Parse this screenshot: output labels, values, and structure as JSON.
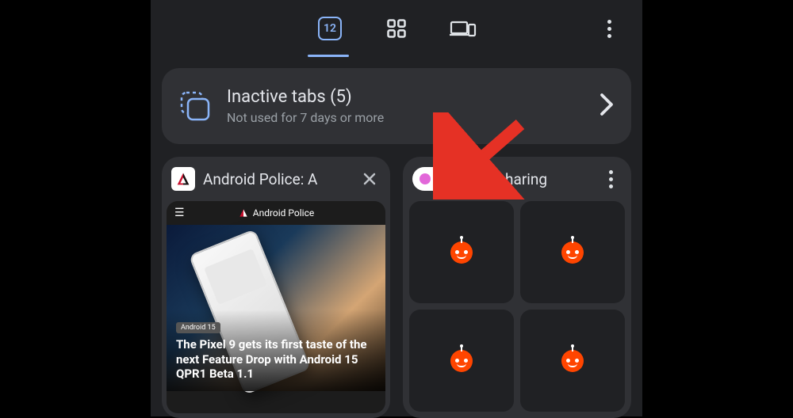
{
  "toolbar": {
    "tab_count": "12"
  },
  "inactive": {
    "title": "Inactive tabs (5)",
    "subtitle": "Not used for 7 days or more"
  },
  "tabs": [
    {
      "title": "Android Police: A",
      "article_badge": "Android 15",
      "article_headline": "The Pixel 9 gets its first taste of the next Feature Drop with Android 15 QPR1 Beta 1.1",
      "site_name": "Android Police"
    },
    {
      "title": "Test sharing"
    }
  ]
}
